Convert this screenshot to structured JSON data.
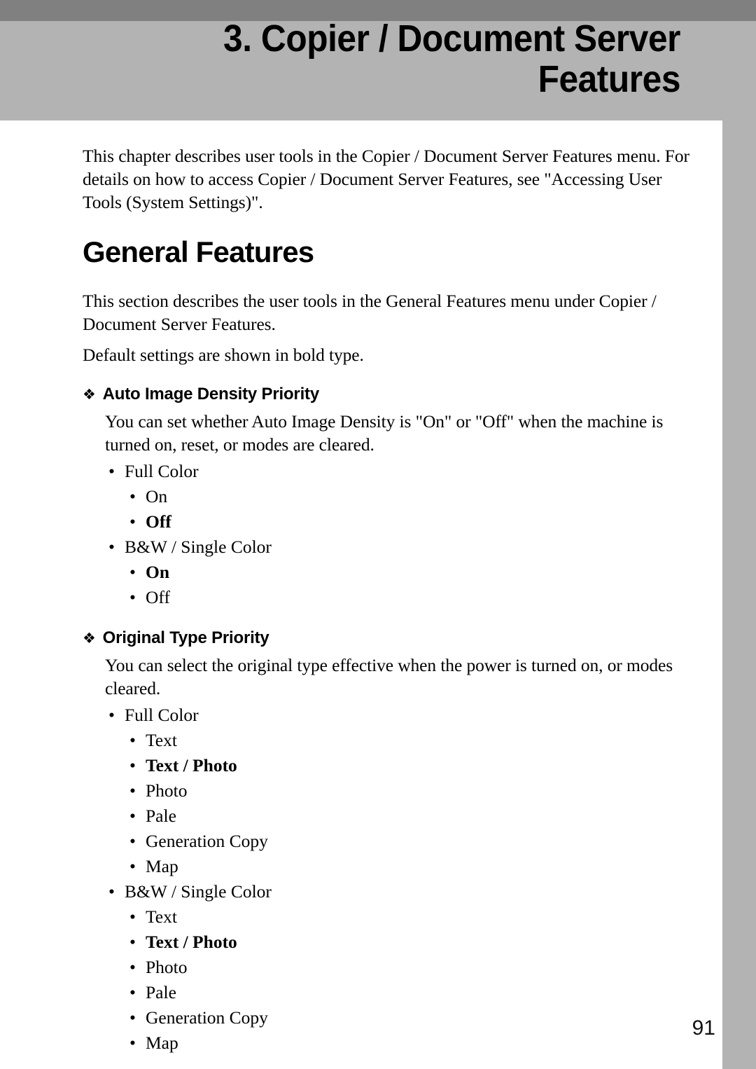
{
  "header": {
    "chapter_title": "3. Copier / Document Server\nFeatures"
  },
  "intro": {
    "paragraph": "This chapter describes user tools in the Copier / Document Server Features menu. For details on how to access Copier / Document Server Features, see \"Accessing User Tools (System Settings)\"."
  },
  "general_features": {
    "heading": "General Features",
    "paragraph_1": "This section describes the user tools in the General Features menu under Copier / Document Server Features.",
    "paragraph_2": "Default settings are shown in bold type."
  },
  "bullets": {
    "diamond": "❖",
    "dot": "•"
  },
  "sections": [
    {
      "title": "Auto Image Density Priority",
      "body": "You can set whether Auto Image Density is \"On\" or \"Off\" when the machine is turned on, reset, or modes are cleared.",
      "groups": [
        {
          "label": "Full Color",
          "options": [
            {
              "label": "On",
              "bold": false
            },
            {
              "label": "Off",
              "bold": true
            }
          ]
        },
        {
          "label": "B&W / Single Color",
          "options": [
            {
              "label": "On",
              "bold": true
            },
            {
              "label": "Off",
              "bold": false
            }
          ]
        }
      ]
    },
    {
      "title": "Original Type Priority",
      "body": "You can select the original type effective when the power is turned on, or modes cleared.",
      "groups": [
        {
          "label": "Full Color",
          "options": [
            {
              "label": "Text",
              "bold": false
            },
            {
              "label": "Text / Photo",
              "bold": true
            },
            {
              "label": "Photo",
              "bold": false
            },
            {
              "label": "Pale",
              "bold": false
            },
            {
              "label": "Generation Copy",
              "bold": false
            },
            {
              "label": "Map",
              "bold": false
            }
          ]
        },
        {
          "label": "B&W / Single Color",
          "options": [
            {
              "label": "Text",
              "bold": false
            },
            {
              "label": "Text / Photo",
              "bold": true
            },
            {
              "label": "Photo",
              "bold": false
            },
            {
              "label": "Pale",
              "bold": false
            },
            {
              "label": "Generation Copy",
              "bold": false
            },
            {
              "label": "Map",
              "bold": false
            }
          ]
        }
      ]
    }
  ],
  "footer": {
    "page_number": "91"
  },
  "colors": {
    "band_dark": "#808080",
    "band_light": "#b3b3b3",
    "text": "#000000",
    "page_background": "#ffffff"
  }
}
